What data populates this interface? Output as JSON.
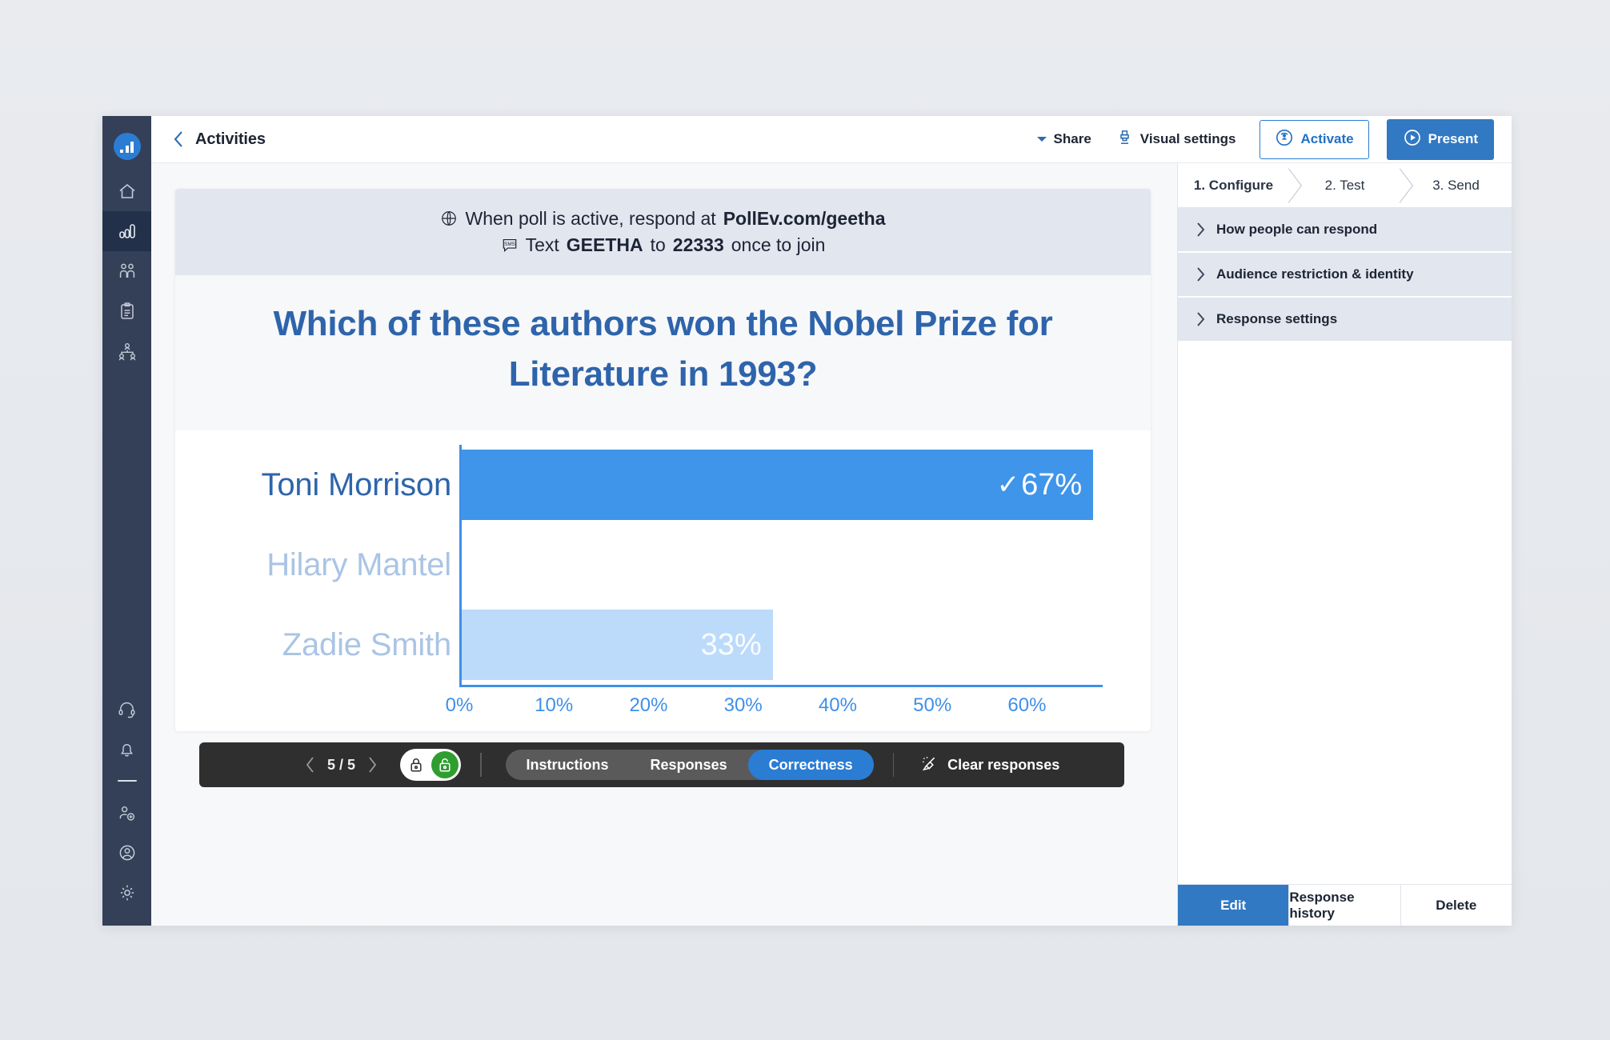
{
  "app": {
    "brand_color": "#2b7cd3",
    "rail_bg": "#344057",
    "logo_name": "bar-chart-logo"
  },
  "sidebar": {
    "items": [
      {
        "name": "home",
        "label": "Home"
      },
      {
        "name": "activities",
        "label": "Activities",
        "active": true
      },
      {
        "name": "participants",
        "label": "Participants"
      },
      {
        "name": "reports",
        "label": "Reports"
      },
      {
        "name": "groups",
        "label": "Groups"
      }
    ],
    "bottom_items": [
      {
        "name": "support",
        "label": "Support"
      },
      {
        "name": "notifications",
        "label": "Notifications"
      },
      {
        "name": "invite",
        "label": "Invite"
      },
      {
        "name": "account",
        "label": "Account"
      },
      {
        "name": "settings",
        "label": "Settings"
      }
    ]
  },
  "header": {
    "back_label": "Activities",
    "share_label": "Share",
    "visual_settings_label": "Visual settings",
    "activate_label": "Activate",
    "present_label": "Present"
  },
  "poll": {
    "instructions": {
      "line1_prefix": "When poll is active, respond at",
      "line1_url": "PollEv.com/geetha",
      "line2_prefix": "Text",
      "line2_keyword": "GEETHA",
      "line2_mid": "to",
      "line2_number": "22333",
      "line2_suffix": "once to join"
    },
    "question": "Which of these authors won the Nobel Prize for Literature in 1993?"
  },
  "chart_data": {
    "type": "bar",
    "orientation": "horizontal",
    "title": "Which of these authors won the Nobel Prize for Literature in 1993?",
    "xlabel": "",
    "ylabel": "",
    "xlim": [
      0,
      68
    ],
    "grid": false,
    "legend": null,
    "tick_labels": [
      "0%",
      "10%",
      "20%",
      "30%",
      "40%",
      "50%",
      "60%"
    ],
    "tick_values": [
      0,
      10,
      20,
      30,
      40,
      50,
      60
    ],
    "categories": [
      "Toni Morrison",
      "Hilary Mantel",
      "Zadie Smith"
    ],
    "values": [
      67,
      0,
      33
    ],
    "value_labels": [
      "67%",
      "",
      "33%"
    ],
    "correct": [
      true,
      false,
      false
    ],
    "correct_mark": "✓",
    "bar_colors": [
      "#3f95ea",
      "#bcdbfb",
      "#bcdbfb"
    ],
    "label_colors": [
      "#2e64ab",
      "#aac4e4",
      "#aac4e4"
    ],
    "axis_color": "#3f8fe8"
  },
  "toolbar": {
    "page_indicator": "5 / 5",
    "prev_label": "Previous",
    "next_label": "Next",
    "lock_locked_name": "lock-closed-icon",
    "lock_unlocked_name": "lock-open-icon",
    "lock_state": "unlocked",
    "segments": [
      {
        "label": "Instructions",
        "active": false
      },
      {
        "label": "Responses",
        "active": false
      },
      {
        "label": "Correctness",
        "active": true
      }
    ],
    "clear_label": "Clear responses"
  },
  "side_panel": {
    "steps": [
      {
        "label": "1. Configure",
        "current": true
      },
      {
        "label": "2. Test",
        "current": false
      },
      {
        "label": "3. Send",
        "current": false
      }
    ],
    "sections": [
      {
        "label": "How people can respond"
      },
      {
        "label": "Audience restriction & identity"
      },
      {
        "label": "Response settings"
      }
    ],
    "footer": [
      {
        "label": "Edit",
        "primary": true
      },
      {
        "label": "Response history",
        "primary": false
      },
      {
        "label": "Delete",
        "primary": false
      }
    ]
  }
}
